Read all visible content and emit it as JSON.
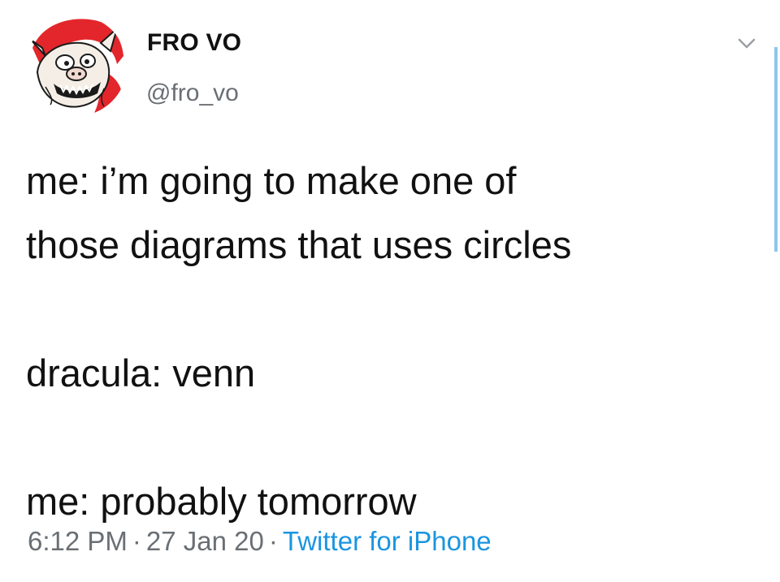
{
  "user": {
    "display_name": "FRO VO",
    "handle": "@fro_vo",
    "avatar_icon": "pig-creature-avatar"
  },
  "tweet": {
    "lines": [
      "me: i’m going to make one of",
      "those diagrams that uses circles"
    ],
    "para2": "dracula: venn",
    "para3": "me: probably tomorrow"
  },
  "meta": {
    "time": "6:12 PM",
    "separator": "·",
    "date": "27 Jan 20",
    "source": "Twitter for iPhone"
  },
  "icons": {
    "caret": "chevron-down-icon"
  },
  "colors": {
    "text": "#111111",
    "muted": "#6a6f74",
    "link": "#1b95e0",
    "avatar_red": "#e3262b"
  }
}
